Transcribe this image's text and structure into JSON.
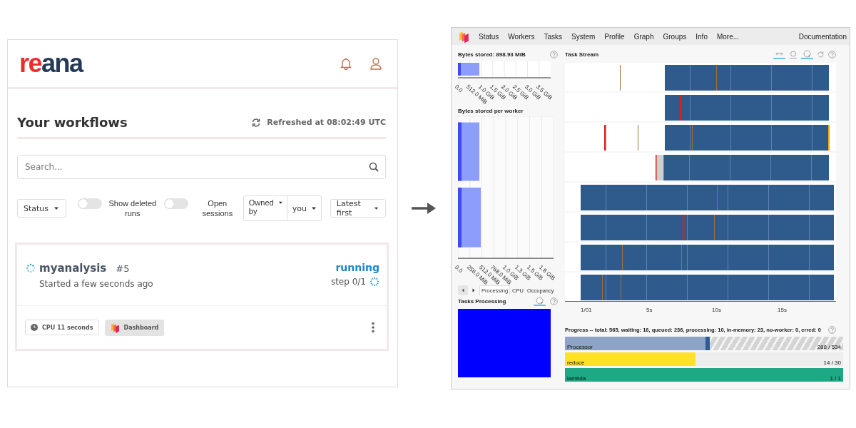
{
  "reana": {
    "logo": {
      "accent": "re",
      "rest": "ana"
    },
    "title": "Your workflows",
    "refreshed": "Refreshed at 08:02:49 UTC",
    "search": {
      "placeholder": "Search..."
    },
    "filters": [
      {
        "kind": "dropdown",
        "label": "Status"
      },
      {
        "kind": "toggle",
        "label": "Show deleted runs",
        "on": false
      },
      {
        "kind": "toggle",
        "label": "Open sessions",
        "on": false
      },
      {
        "kind": "split",
        "label": "Owned by",
        "option": "you"
      },
      {
        "kind": "dropdown",
        "label": "Latest first"
      }
    ],
    "workflow": {
      "name": "myanalysis",
      "run": "#5",
      "started": "Started a few seconds ago",
      "status": "running",
      "step": "step 0/1",
      "cpu": "CPU 11 seconds",
      "dashboard": "Dashboard"
    }
  },
  "dask": {
    "menu": [
      "Status",
      "Workers",
      "Tasks",
      "System",
      "Profile",
      "Graph",
      "Groups",
      "Info",
      "More..."
    ],
    "documentation": "Documentation",
    "bytes_stored": {
      "title": "Bytes stored: 898.93 MiB",
      "ticks": [
        "0.0",
        "512.0 MiB",
        "1.0 GiB",
        "1.5 GiB",
        "2.0 GiB",
        "2.5 GiB",
        "3.0 GiB",
        "3.5 GiB"
      ]
    },
    "bytes_per_worker": {
      "title": "Bytes stored per worker",
      "ticks": [
        "0.0",
        "256.0 MiB",
        "512.0 MiB",
        "768.0 MiB",
        "1.0 GiB",
        "1.3 GiB",
        "1.5 GiB",
        "1.8 GiB"
      ]
    },
    "tabs": [
      {
        "label": "Processing",
        "selected": true
      },
      {
        "label": "CPU",
        "selected": false
      },
      {
        "label": "Occupancy",
        "selected": false
      }
    ],
    "tasks_processing": {
      "title": "Tasks Processing"
    },
    "task_stream": {
      "title": "Task Stream",
      "ticks": [
        "1/01",
        "5s",
        "10s",
        "15s"
      ]
    },
    "progress": {
      "summary": "Progress -- total: 565, waiting: 16, queued: 236, processing: 10, in-memory: 23, no-worker: 0, erred: 0",
      "bars": [
        {
          "name": "Processor",
          "count": "288 / 534",
          "level": 0.52,
          "color": "#8ea4c6"
        },
        {
          "name": "reduce",
          "count": "14 / 30",
          "level": 0.47,
          "color": "#ffe127"
        },
        {
          "name": "lambda",
          "count": "1 / 1",
          "level": 1,
          "color": "#1fa884"
        }
      ]
    }
  }
}
